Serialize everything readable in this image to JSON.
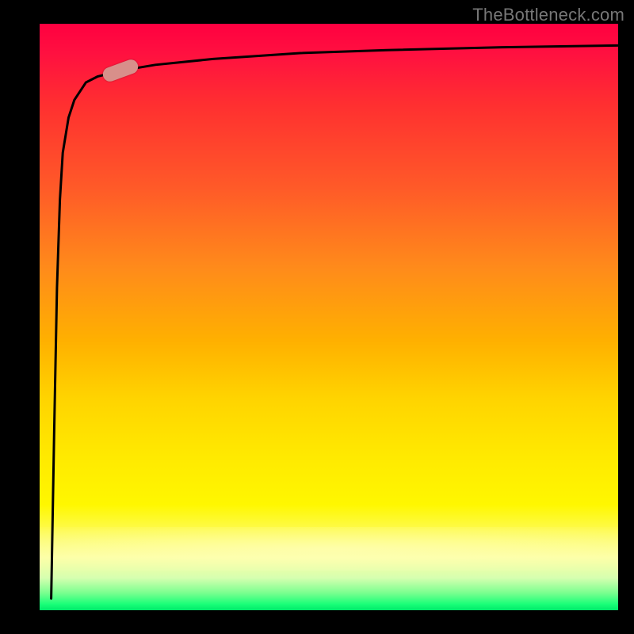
{
  "watermark": "TheBottleneck.com",
  "chart_data": {
    "type": "line",
    "title": "",
    "xlabel": "",
    "ylabel": "",
    "xlim": [
      0,
      100
    ],
    "ylim": [
      0,
      100
    ],
    "grid": false,
    "legend": false,
    "annotations": [],
    "background_gradient": {
      "orientation": "vertical",
      "stops": [
        {
          "pct": 0,
          "color": "#ff0040",
          "meaning": "high-bottleneck"
        },
        {
          "pct": 50,
          "color": "#ffb000",
          "meaning": "mid"
        },
        {
          "pct": 85,
          "color": "#fff700",
          "meaning": "low-mid"
        },
        {
          "pct": 100,
          "color": "#00e86a",
          "meaning": "ok"
        }
      ]
    },
    "series": [
      {
        "name": "bottleneck-curve",
        "x": [
          2,
          2.5,
          3,
          3.5,
          4,
          5,
          6,
          8,
          10,
          14,
          20,
          30,
          45,
          60,
          80,
          100
        ],
        "y": [
          2,
          30,
          55,
          70,
          78,
          84,
          87,
          90,
          91,
          92,
          93,
          94,
          95,
          95.5,
          96,
          96.3
        ],
        "style": {
          "stroke": "#000000",
          "width": 2
        }
      }
    ],
    "marker": {
      "approx_x": 14,
      "approx_y": 92,
      "color": "#d88f8a",
      "shape": "pill"
    }
  }
}
